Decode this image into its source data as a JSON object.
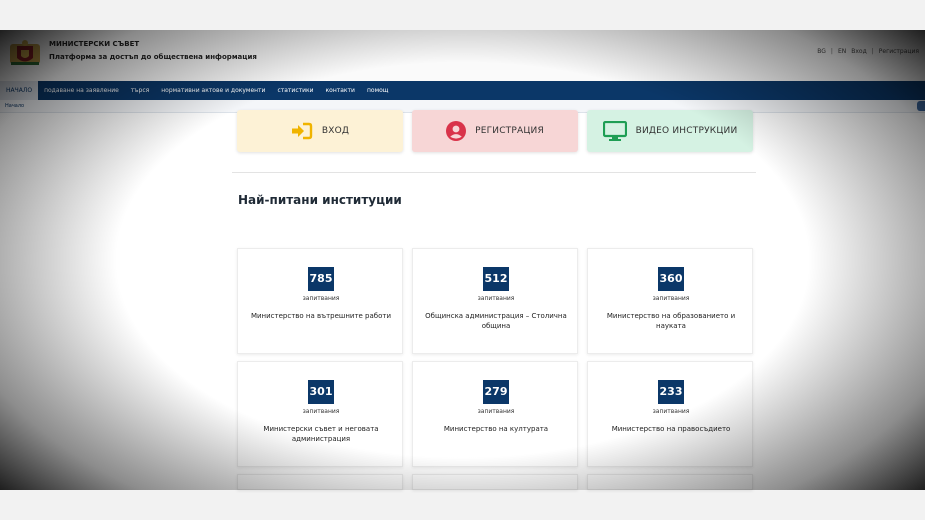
{
  "header": {
    "org_name": "МИНИСТЕРСКИ СЪВЕТ",
    "platform_name": "Платформа за достъп до обществена информация",
    "utility": [
      "BG",
      "EN",
      "Вход",
      "Регистрация"
    ]
  },
  "nav": {
    "items": [
      "НАЧАЛО",
      "подаване на заявление",
      "търся",
      "нормативни актове и документи",
      "статистики",
      "контакти",
      "помощ"
    ]
  },
  "breadcrumb": "Начало",
  "actions": {
    "login": "ВХОД",
    "register": "РЕГИСТРАЦИЯ",
    "video": "ВИДЕО ИНСТРУКЦИИ"
  },
  "section_title": "Най-питани институции",
  "institutions": [
    {
      "count": "785",
      "label": "запитвания",
      "name": "Министерство на вътрешните работи"
    },
    {
      "count": "512",
      "label": "запитвания",
      "name": "Общинска администрация – Столична община"
    },
    {
      "count": "360",
      "label": "запитвания",
      "name": "Министерство на образованието и науката"
    },
    {
      "count": "301",
      "label": "запитвания",
      "name": "Министерски съвет и неговата администрация"
    },
    {
      "count": "279",
      "label": "запитвания",
      "name": "Министерство на културата"
    },
    {
      "count": "233",
      "label": "запитвания",
      "name": "Министерство на правосъдието"
    }
  ],
  "colors": {
    "nav_bg": "#0b3768",
    "count_bg": "#0b3768",
    "login_bg": "#fdf2d6",
    "login_icon": "#f0b400",
    "register_bg": "#f7d6d6",
    "register_icon": "#d9334a",
    "video_bg": "#d5f2e3",
    "video_icon": "#1e9e54"
  },
  "icons": {
    "login": "sign-in-icon",
    "register": "user-circle-icon",
    "video": "monitor-icon"
  }
}
